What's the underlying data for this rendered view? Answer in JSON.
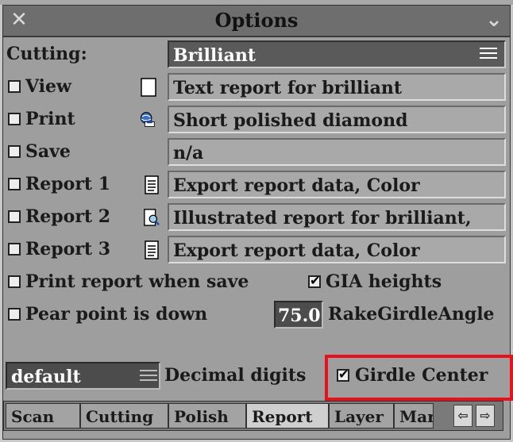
{
  "window": {
    "title": "Options",
    "close_glyph": "✕",
    "minimize_glyph": "⌄"
  },
  "cutting": {
    "label": "Cutting:",
    "value": "Brilliant"
  },
  "outputs": [
    {
      "label": "View",
      "checked": false,
      "icon": "blank-page-icon",
      "value": "Text report for brilliant"
    },
    {
      "label": "Print",
      "checked": false,
      "icon": "printer-globe-icon",
      "value": "Short polished diamond"
    },
    {
      "label": "Save",
      "checked": false,
      "icon": "",
      "value": "n/a"
    },
    {
      "label": "Report 1",
      "checked": false,
      "icon": "document-list-icon",
      "value": "Export report data, Color"
    },
    {
      "label": "Report 2",
      "checked": false,
      "icon": "document-magnifier-icon",
      "value": "Illustrated report for brilliant,"
    },
    {
      "label": "Report 3",
      "checked": false,
      "icon": "document-list-icon",
      "value": "Export report data, Color"
    }
  ],
  "options": {
    "print_report_when_save": {
      "label": "Print report when save",
      "checked": false
    },
    "gia_heights": {
      "label": "GIA heights",
      "checked": true
    },
    "pear_point_is_down": {
      "label": "Pear point is down",
      "checked": false
    },
    "rake_girdle_angle": {
      "value": "75.0",
      "label": "RakeGirdleAngle"
    },
    "decimal_digits": {
      "value": "default",
      "label": "Decimal digits"
    },
    "girdle_center": {
      "label": "Girdle Center",
      "checked": true
    }
  },
  "tabs": [
    {
      "label": "Scan",
      "active": false
    },
    {
      "label": "Cutting",
      "active": false
    },
    {
      "label": "Polish",
      "active": false
    },
    {
      "label": "Report",
      "active": true
    },
    {
      "label": "Layer",
      "active": false
    },
    {
      "label": "Mar",
      "active": false
    }
  ],
  "tab_scroll": {
    "left_glyph": "⇦",
    "right_glyph": "⇨"
  },
  "colors": {
    "highlight": "#e8101a",
    "window_bg": "#9e9e9e",
    "titlebar": "#6e6e6e",
    "field_dark": "#5a5a5a"
  }
}
